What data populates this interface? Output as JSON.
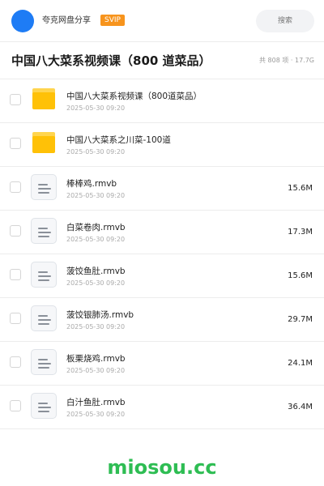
{
  "header": {
    "username": "夸克网盘分享",
    "badge": "SVIP",
    "search_placeholder": "搜索"
  },
  "page": {
    "title": "中国八大菜系视频课（800 道菜品）",
    "summary": "共 808 项 · 17.7G"
  },
  "files": [
    {
      "type": "folder",
      "name": "中国八大菜系视频课（800道菜品）",
      "date": "2025-05-30 09:20",
      "size": ""
    },
    {
      "type": "folder",
      "name": "中国八大菜系之川菜-100道",
      "date": "2025-05-30 09:20",
      "size": ""
    },
    {
      "type": "file",
      "name": "棒棒鸡.rmvb",
      "date": "2025-05-30 09:20",
      "size": "15.6M"
    },
    {
      "type": "file",
      "name": "白菜卷肉.rmvb",
      "date": "2025-05-30 09:20",
      "size": "17.3M"
    },
    {
      "type": "file",
      "name": "菠饺鱼肚.rmvb",
      "date": "2025-05-30 09:20",
      "size": "15.6M"
    },
    {
      "type": "file",
      "name": "菠饺银肺汤.rmvb",
      "date": "2025-05-30 09:20",
      "size": "29.7M"
    },
    {
      "type": "file",
      "name": "板栗烧鸡.rmvb",
      "date": "2025-05-30 09:20",
      "size": "24.1M"
    },
    {
      "type": "file",
      "name": "白汁鱼肚.rmvb",
      "date": "2025-05-30 09:20",
      "size": "36.4M"
    }
  ],
  "watermark": "miosou.cc",
  "colors": {
    "avatar": "#1e7cf5",
    "badge": "#f7941d",
    "folder": "#ffc107",
    "watermark": "#2ebd53"
  },
  "icons": {
    "folder": "folder-icon",
    "file": "video-file-icon"
  }
}
